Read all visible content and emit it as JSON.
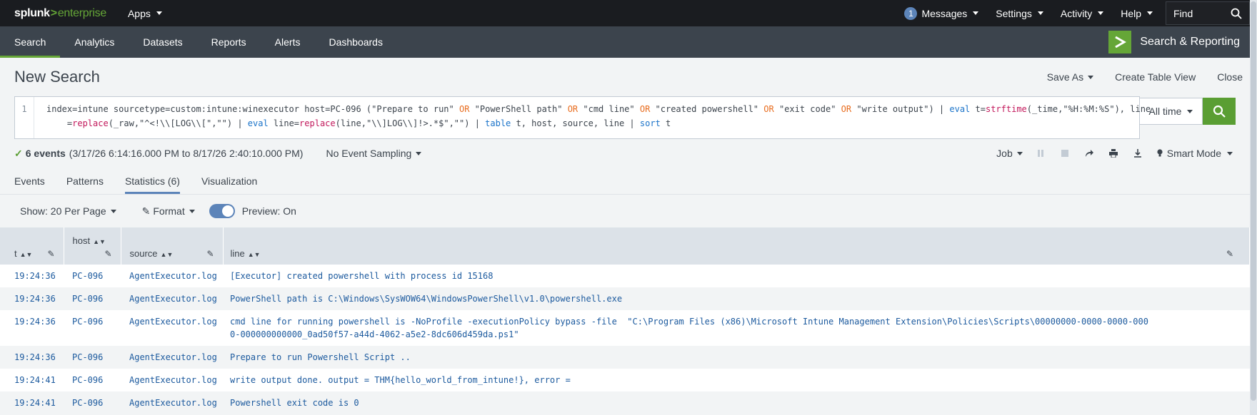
{
  "brand": {
    "prefix": "splunk",
    "gt": ">",
    "suffix": "enterprise"
  },
  "topnav": {
    "apps": "Apps",
    "messages_count": "1",
    "messages": "Messages",
    "settings": "Settings",
    "activity": "Activity",
    "help": "Help",
    "find": "Find"
  },
  "appnav": {
    "tabs": [
      "Search",
      "Analytics",
      "Datasets",
      "Reports",
      "Alerts",
      "Dashboards"
    ],
    "app_title": "Search & Reporting"
  },
  "page": {
    "title": "New Search",
    "save_as": "Save As",
    "create_table_view": "Create Table View",
    "close": "Close"
  },
  "search": {
    "line_number": "1",
    "time_range": "All time"
  },
  "status": {
    "event_count": "6 events",
    "range": "(3/17/26 6:14:16.000 PM to 8/17/26 2:40:10.000 PM)",
    "sampling": "No Event Sampling",
    "job": "Job",
    "mode": "Smart Mode"
  },
  "results_tabs": [
    "Events",
    "Patterns",
    "Statistics (6)",
    "Visualization"
  ],
  "options": {
    "per_page": "Show: 20 Per Page",
    "format": "Format",
    "preview": "Preview: On"
  },
  "table": {
    "columns": [
      "t",
      "host",
      "source",
      "line"
    ],
    "rows": [
      [
        "19:24:36",
        "PC-096",
        "AgentExecutor.log",
        "[Executor] created powershell with process id 15168"
      ],
      [
        "19:24:36",
        "PC-096",
        "AgentExecutor.log",
        "PowerShell path is C:\\Windows\\SysWOW64\\WindowsPowerShell\\v1.0\\powershell.exe"
      ],
      [
        "19:24:36",
        "PC-096",
        "AgentExecutor.log",
        "cmd line for running powershell is -NoProfile -executionPolicy bypass -file  \"C:\\Program Files (x86)\\Microsoft Intune Management Extension\\Policies\\Scripts\\00000000-0000-0000-0000-000000000000_0ad50f57-a44d-4062-a5e2-8dc606d459da.ps1\""
      ],
      [
        "19:24:36",
        "PC-096",
        "AgentExecutor.log",
        "Prepare to run Powershell Script .."
      ],
      [
        "19:24:41",
        "PC-096",
        "AgentExecutor.log",
        "write output done. output = THM{hello_world_from_intune!}, error ="
      ],
      [
        "19:24:41",
        "PC-096",
        "AgentExecutor.log",
        "Powershell exit code is 0"
      ]
    ]
  },
  "colors": {
    "accent_green": "#65a637",
    "accent_blue": "#5c84b9",
    "topbar": "#1a1c20",
    "appbar": "#3c444d"
  },
  "icons": [
    "search-icon",
    "pause-icon",
    "stop-icon",
    "share-icon",
    "print-icon",
    "export-icon",
    "pencil-icon",
    "bulb-icon",
    "chevron-right-icon"
  ]
}
